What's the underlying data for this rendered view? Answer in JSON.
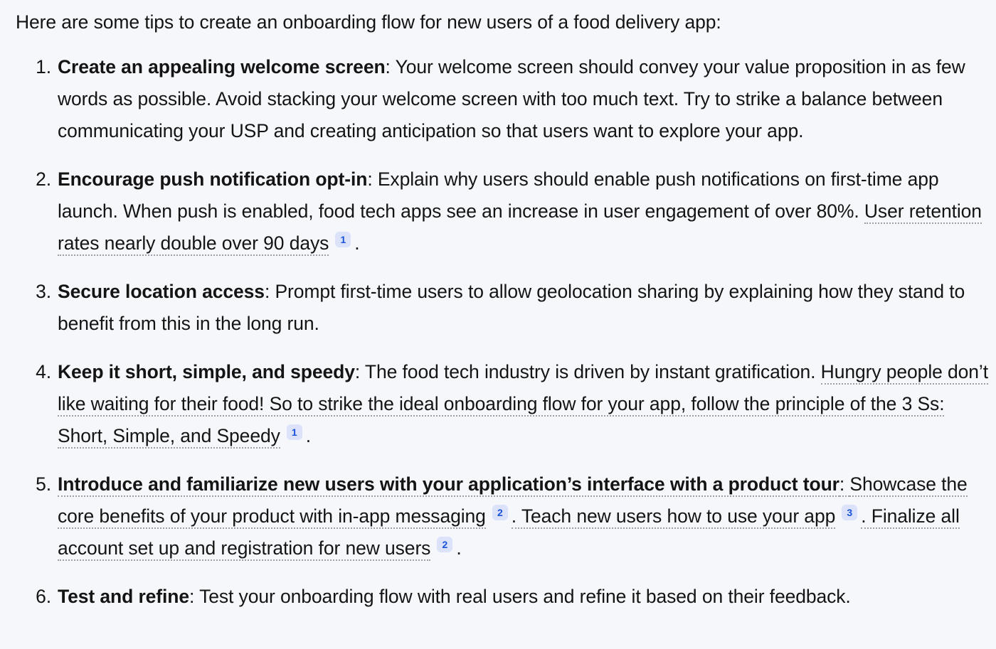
{
  "answer": {
    "intro": "Here are some tips to create an onboarding flow for new users of a food delivery app:",
    "tips": [
      {
        "number": "1.",
        "lead": "Create an appealing welcome screen",
        "separator": ": ",
        "body": "Your welcome screen should convey your value proposition in as few words as possible. Avoid stacking your welcome screen with too much text. Try to strike a balance between communicating your USP and creating anticipation so that users want to explore your app."
      },
      {
        "number": "2.",
        "lead": "Encourage push notification opt-in",
        "separator": ": ",
        "body_plain": "Explain why users should enable push notifications on first-time app launch. When push is enabled, food tech apps see an increase in user engagement of over 80%. ",
        "cited_text": "User retention rates nearly double over 90 days",
        "cite_number": "1",
        "trailing": "."
      },
      {
        "number": "3.",
        "lead": "Secure location access",
        "separator": ": ",
        "body": "Prompt first-time users to allow geolocation sharing by explaining how they stand to benefit from this in the long run."
      },
      {
        "number": "4.",
        "lead": "Keep it short, simple, and speedy",
        "separator": ": ",
        "body_plain": "The food tech industry is driven by instant gratification. ",
        "cited_text": "Hungry people don’t like waiting for their food! So to strike the ideal onboarding flow for your app, follow the principle of the 3 Ss: Short, Simple, and Speedy",
        "cite_number": "1",
        "trailing": "."
      },
      {
        "number": "5.",
        "lead": "Introduce and familiarize new users with your application’s interface with a product tour",
        "separator": ": ",
        "segments": [
          {
            "text": "Showcase the core benefits of your product with in-app messaging",
            "cite": "2"
          },
          {
            "text": ". Teach new users how to use your app",
            "cite": "3"
          },
          {
            "text": ". Finalize all account set up and registration for new users",
            "cite": "2"
          }
        ],
        "trailing": "."
      },
      {
        "number": "6.",
        "lead": "Test and refine",
        "separator": ": ",
        "body": "Test your onboarding flow with real users and refine it based on their feedback."
      }
    ]
  },
  "colors": {
    "page_background": "#f5f7fb",
    "text": "#141414",
    "citation_badge_background": "#dbe2f9",
    "citation_badge_text": "#1a53d8",
    "dotted_underline": "#9aa0a6"
  }
}
